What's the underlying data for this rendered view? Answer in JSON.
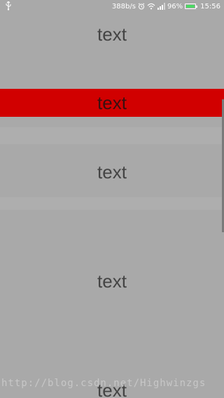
{
  "status_bar": {
    "net_speed": "388b/s",
    "battery_percent": "96%",
    "battery_level": 0.96,
    "time": "15:56",
    "icons": [
      "usb-icon",
      "alarm-icon",
      "wifi-icon",
      "signal-icon",
      "battery-icon"
    ]
  },
  "list": {
    "items": [
      {
        "label": "text",
        "selected": false
      },
      {
        "label": "text",
        "selected": true
      },
      {
        "label": "text",
        "selected": false
      },
      {
        "label": "text",
        "selected": false
      },
      {
        "label": "text",
        "selected": false
      }
    ],
    "selected_color": "#d10000",
    "background_color": "#a9a9a9"
  },
  "watermark": "http://blog.csdn.net/Highwinzgs"
}
